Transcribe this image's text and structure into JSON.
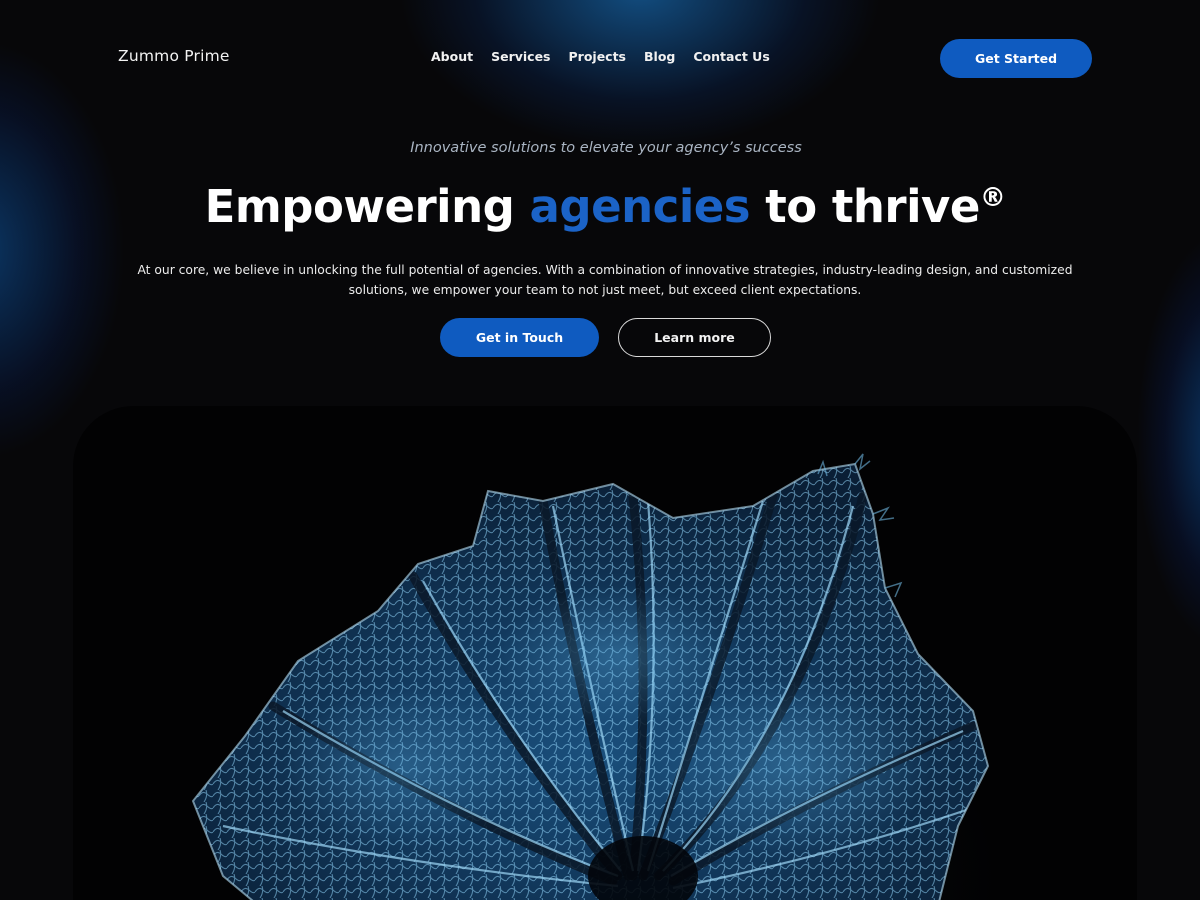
{
  "header": {
    "logo": "Zummo Prime",
    "nav": [
      "About",
      "Services",
      "Projects",
      "Blog",
      "Contact Us"
    ],
    "cta": "Get Started"
  },
  "hero": {
    "tagline": "Innovative solutions to elevate your agency’s success",
    "headline_start": "Empowering",
    "headline_accent": "agencies",
    "headline_end": "to thrive",
    "headline_mark": "®",
    "description": "At our core, we believe in unlocking the full potential of agencies. With a combination of innovative strategies, industry-leading design, and customized solutions, we empower your team to not just meet, but exceed client expectations.",
    "primary_button": "Get in Touch",
    "secondary_button": "Learn more"
  },
  "image": {
    "subject": "blue physalis husk skeleton on black background"
  },
  "colors": {
    "accent": "#0f5bc0",
    "background": "#070709",
    "text": "#ffffff"
  }
}
